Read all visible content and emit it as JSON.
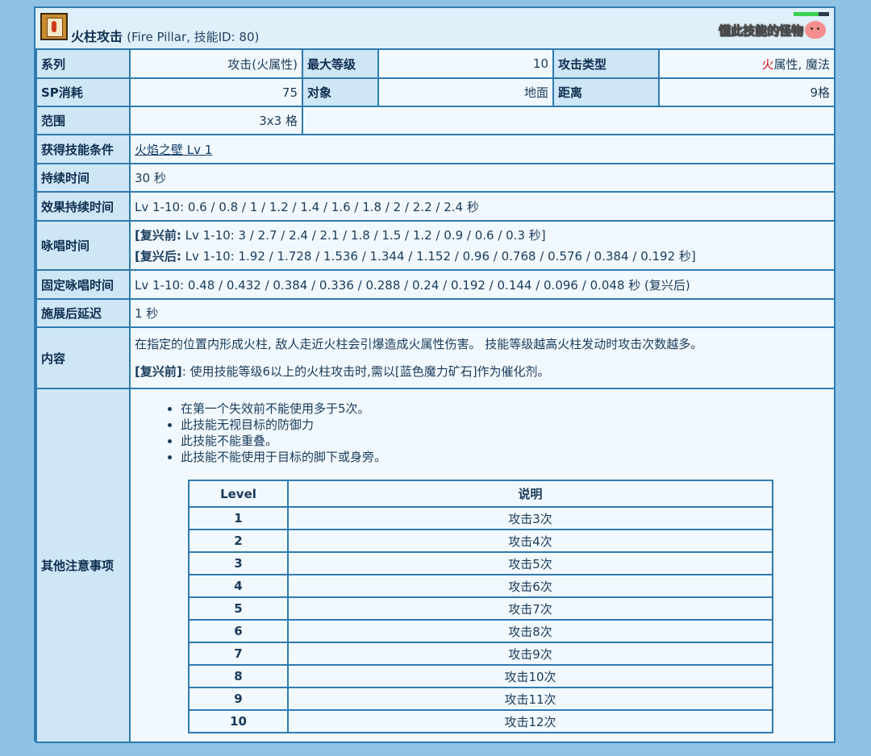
{
  "skill": {
    "name": "火柱攻击",
    "subtitle": "(Fire Pillar, 技能ID: 80)",
    "icon": "fire-pillar-skill-icon",
    "monster_link": "懂此技能的怪物",
    "monster_icon": "poring-icon"
  },
  "rows": {
    "series": {
      "label": "系列",
      "value": "攻击(火属性)"
    },
    "max_level": {
      "label": "最大等级",
      "value": "10"
    },
    "attack_type": {
      "label": "攻击类型",
      "fire": "火",
      "value": "属性, 魔法"
    },
    "sp_cost": {
      "label": "SP消耗",
      "value": "75"
    },
    "target": {
      "label": "对象",
      "value": "地面"
    },
    "range": {
      "label": "距离",
      "value": "9格"
    },
    "area": {
      "label": "范围",
      "value": "3x3 格"
    },
    "requirement": {
      "label": "获得技能条件",
      "value": "火焰之壁 Lv 1"
    },
    "duration": {
      "label": "持续时间",
      "value": "30 秒"
    },
    "effect_duration": {
      "label": "效果持续时间",
      "value": "Lv 1-10: 0.6 / 0.8 / 1 / 1.2 / 1.4 / 1.6 / 1.8 / 2 / 2.2 / 2.4 秒"
    },
    "cast_time": {
      "label": "咏唱时间",
      "pre_tag": "[复兴前:",
      "pre_value": " Lv 1-10: 3 / 2.7 / 2.4 / 2.1 / 1.8 / 1.5 / 1.2 / 0.9 / 0.6 / 0.3 秒]",
      "post_tag": "[复兴后:",
      "post_value": " Lv 1-10: 1.92 / 1.728 / 1.536 / 1.344 / 1.152 / 0.96 / 0.768 / 0.576 / 0.384 / 0.192 秒]"
    },
    "fixed_cast": {
      "label": "固定咏唱时间",
      "value": "Lv 1-10: 0.48 / 0.432 / 0.384 / 0.336 / 0.288 / 0.24 / 0.192 / 0.144 / 0.096 / 0.048 秒 (复兴后)"
    },
    "after_delay": {
      "label": "施展后延迟",
      "value": "1 秒"
    },
    "description": {
      "label": "内容",
      "line1": "在指定的位置内形成火柱, 敌人走近火柱会引爆造成火属性伤害。 技能等级越高火柱发动时攻击次数越多。",
      "note_tag": "[复兴前]",
      "note_value": ": 使用技能等级6以上的火柱攻击时,需以[蓝色魔力矿石]作为催化剂。"
    },
    "notes": {
      "label": "其他注意事项",
      "items": [
        "在第一个失效前不能使用多于5次。",
        "此技能无视目标的防御力",
        "此技能不能重叠。",
        "此技能不能使用于目标的脚下或身旁。"
      ]
    }
  },
  "level_table": {
    "headers": [
      "Level",
      "说明"
    ],
    "rows": [
      [
        "1",
        "攻击3次"
      ],
      [
        "2",
        "攻击4次"
      ],
      [
        "3",
        "攻击5次"
      ],
      [
        "4",
        "攻击6次"
      ],
      [
        "5",
        "攻击7次"
      ],
      [
        "6",
        "攻击8次"
      ],
      [
        "7",
        "攻击9次"
      ],
      [
        "8",
        "攻击10次"
      ],
      [
        "9",
        "攻击11次"
      ],
      [
        "10",
        "攻击12次"
      ]
    ]
  },
  "colors": {
    "border": "#2f7bb0",
    "label_bg": "#cfe6f7",
    "value_bg": "#f2f9fe",
    "fire": "#d0101a",
    "hp_bar": "#39d14d"
  },
  "hp_fill_percent": 70
}
